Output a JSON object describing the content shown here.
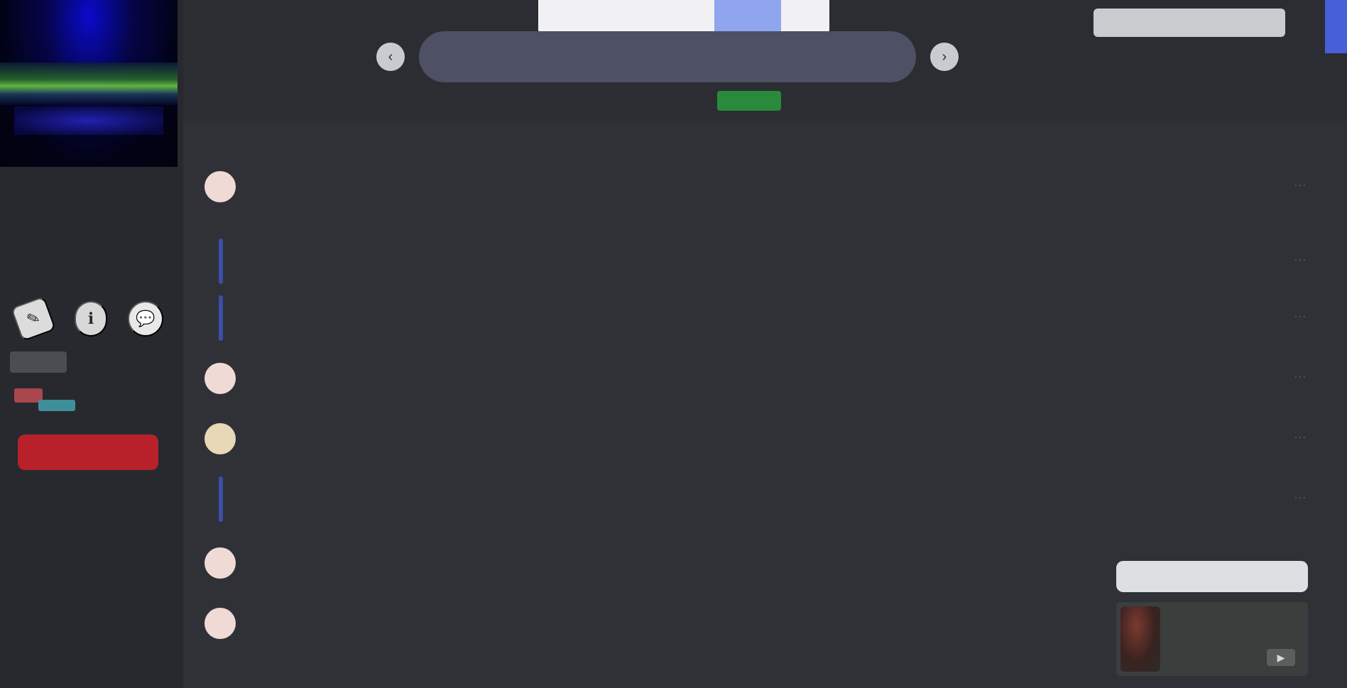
{
  "sidebar": {
    "name": "",
    "section_title": "",
    "actions": [
      {
        "icon": "pencil-icon"
      },
      {
        "icon": "info-icon"
      },
      {
        "icon": "chat-icon"
      }
    ],
    "status": {
      "label": "",
      "sub": ""
    },
    "red_button_label": ""
  },
  "topbar": {
    "download_label": "",
    "download_button": "",
    "search_placeholder": "",
    "search_sub_label": "",
    "search_sub_pill": "",
    "account_label": "",
    "back_icon": "chevron-left-icon",
    "forward_icon": "chevron-right-icon"
  },
  "list": {
    "header": "",
    "rows": [
      {
        "title": "",
        "subtitle": "",
        "meta": "",
        "avatar": "pink"
      },
      {
        "title": "",
        "subtitle": "",
        "meta": "",
        "avatar": "line"
      },
      {
        "title": "",
        "subtitle": "",
        "meta": "",
        "avatar": "line"
      },
      {
        "title": "",
        "subtitle": "",
        "meta": "",
        "avatar": "pink"
      },
      {
        "title": "",
        "subtitle": "",
        "meta": "",
        "avatar": "tan"
      },
      {
        "title": "",
        "subtitle": "",
        "meta": "",
        "avatar": "line"
      },
      {
        "title": "",
        "subtitle": "",
        "meta": "",
        "avatar": "pink"
      },
      {
        "title": "",
        "subtitle": "",
        "meta": "",
        "avatar": "pink"
      }
    ]
  },
  "mini_player": {
    "label": "",
    "caption": "",
    "play_icon": "play-icon"
  },
  "colors": {
    "background": "#2f3137",
    "sidebar": "#27292e",
    "accent_blue": "#8fa5ee",
    "status_green": "#43b64f",
    "danger_red": "#b8212a"
  }
}
